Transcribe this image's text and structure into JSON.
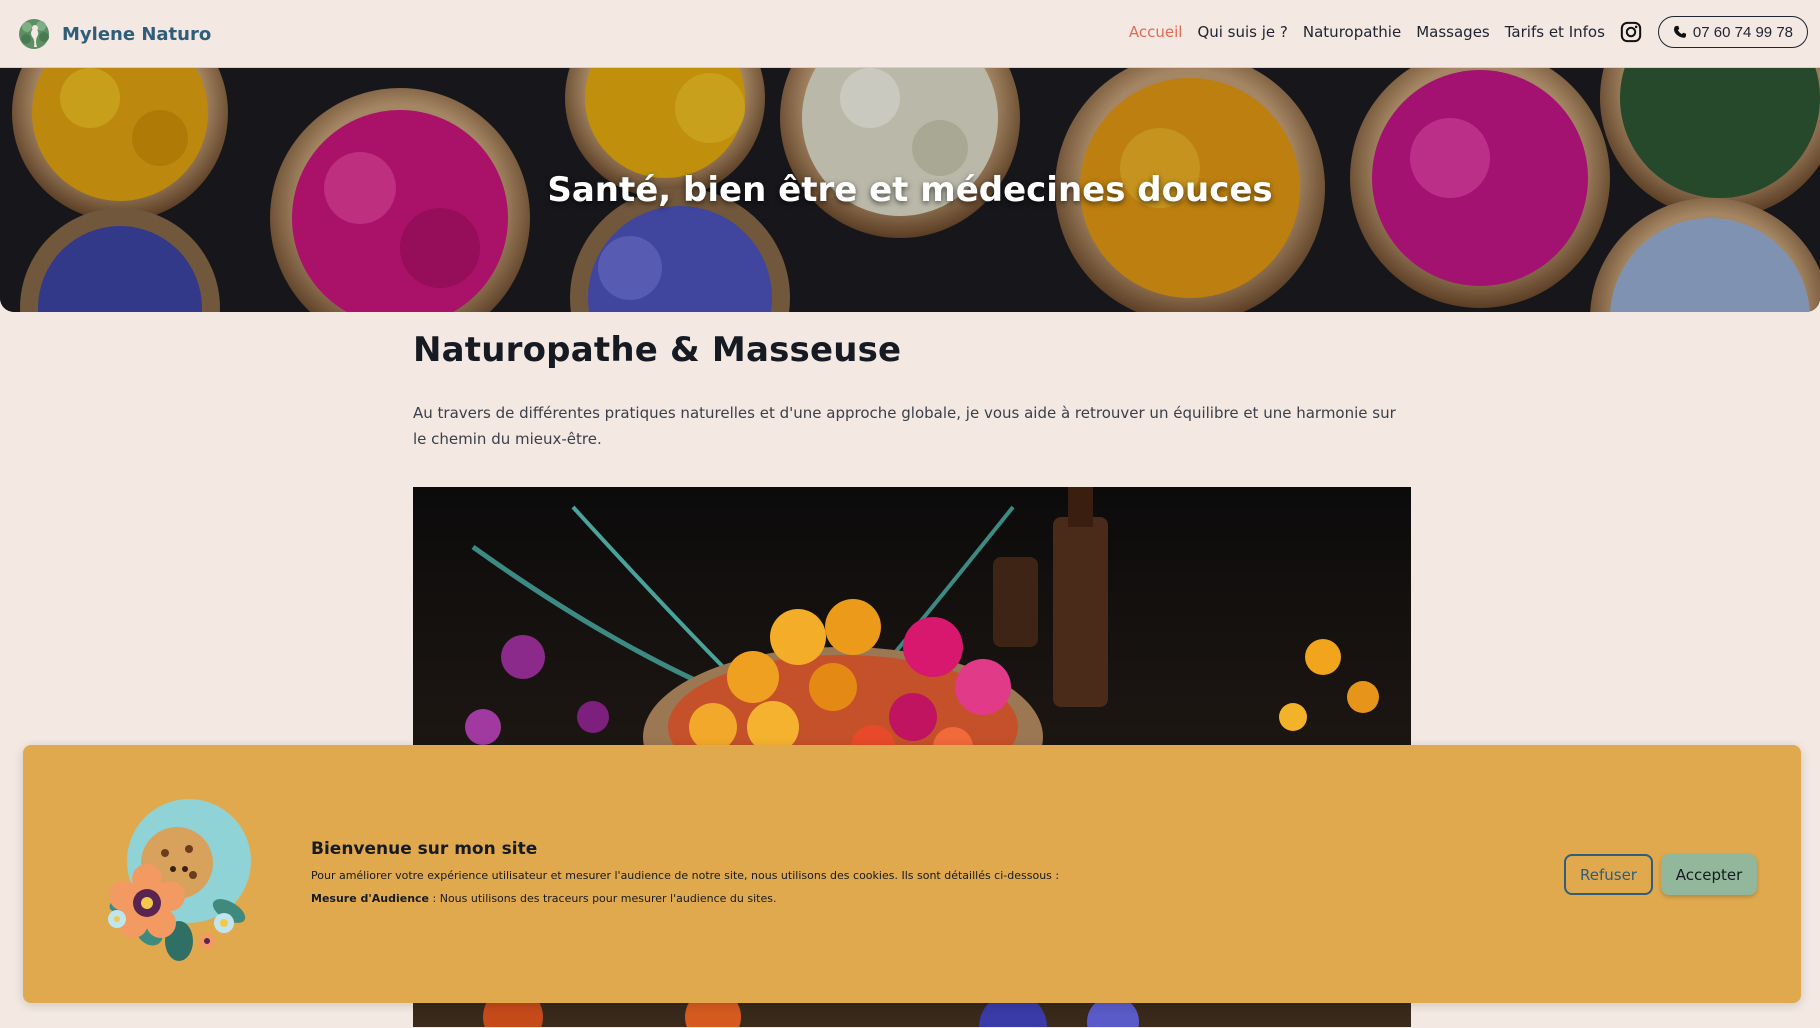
{
  "brand": {
    "name": "Mylene Naturo",
    "logo_icon": "woman-tree-logo-icon"
  },
  "nav": {
    "items": [
      {
        "label": "Accueil",
        "active": true
      },
      {
        "label": "Qui suis je ?",
        "active": false
      },
      {
        "label": "Naturopathie",
        "active": false
      },
      {
        "label": "Massages",
        "active": false
      },
      {
        "label": "Tarifs et Infos",
        "active": false
      }
    ],
    "instagram_icon": "instagram-icon",
    "phone": {
      "label": "07 60 74 99 78",
      "icon": "phone-icon"
    },
    "active_color": "#e06a55"
  },
  "hero": {
    "title": "Santé, bien être et médecines douces"
  },
  "main": {
    "heading": "Naturopathe & Masseuse",
    "text": "Au travers de différentes pratiques naturelles et d'une approche globale, je vous aide à retrouver un équilibre et une harmonie sur le chemin du mieux-être."
  },
  "cookie": {
    "title": "Bienvenue sur mon site",
    "description": "Pour améliorer votre expérience utilisateur et mesurer l'audience de notre site, nous utilisons des cookies. Ils sont détaillés ci-dessous :",
    "measure_label": "Mesure d'Audience",
    "measure_text": " : Nous utilisons des traceurs pour mesurer l'audience du sites.",
    "refuse_label": "Refuser",
    "accept_label": "Accepter",
    "background": "#e0a94e",
    "accept_color": "#93b79b",
    "refuse_color": "#2f5d7a"
  }
}
